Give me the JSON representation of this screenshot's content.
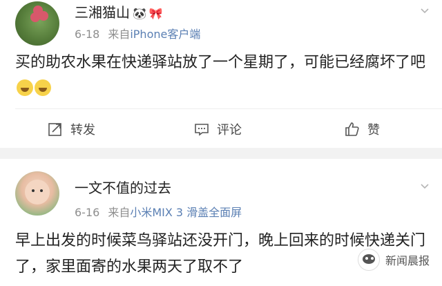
{
  "posts": [
    {
      "username": "三湘猫山",
      "badges": [
        "🐼",
        "🎀"
      ],
      "date": "6-18",
      "via_prefix": "来自",
      "device": "iPhone客户端",
      "content": "买的助农水果在快递驿站放了一个星期了，可能已经腐坏了吧",
      "actions": {
        "repost": "转发",
        "comment": "评论",
        "like": "赞"
      }
    },
    {
      "username": "一文不值的过去",
      "date": "6-16",
      "via_prefix": "来自",
      "device": "小米MIX 3 滑盖全面屏",
      "content": "早上出发的时候菜鸟驿站还没开门，晚上回来的时候快递关门了，家里面寄的水果两天了取不了"
    }
  ],
  "watermark": {
    "text": "新闻晨报"
  },
  "colors": {
    "separator": "#f2f2f2",
    "meta": "#8e8e8e",
    "text": "#222222"
  },
  "icons": {
    "chevron": "chevron-down-icon",
    "repost": "repost-icon",
    "comment": "comment-icon",
    "like": "like-icon"
  }
}
